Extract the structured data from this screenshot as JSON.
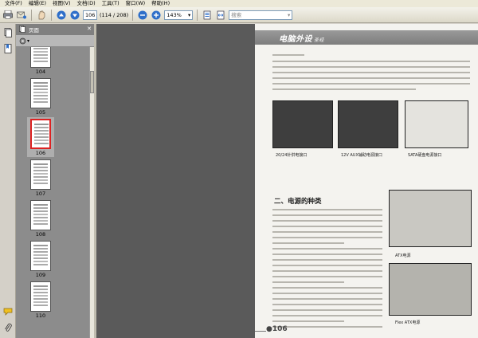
{
  "menu": {
    "items": [
      "文件(F)",
      "编辑(E)",
      "视图(V)",
      "文档(D)",
      "工具(T)",
      "窗口(W)",
      "帮助(H)"
    ]
  },
  "toolbar": {
    "page_number": "106",
    "page_count": "(114 / 208)",
    "zoom": "143%",
    "search_placeholder": "搜索"
  },
  "panel": {
    "title": "页面"
  },
  "thumbnails": [
    {
      "label": "104",
      "selected": false
    },
    {
      "label": "105",
      "selected": false
    },
    {
      "label": "106",
      "selected": true
    },
    {
      "label": "107",
      "selected": false
    },
    {
      "label": "108",
      "selected": false
    },
    {
      "label": "109",
      "selected": false
    },
    {
      "label": "110",
      "selected": false
    }
  ],
  "document": {
    "banner_title": "电脑外设",
    "banner_subtitle": "圣经",
    "section_heading": "二、电源的种类",
    "captions": [
      "20/24针供电接口",
      "12V AUX辅助电源接口",
      "SATA硬盘电源接口",
      "ATX电源",
      "Flex ATX电源"
    ],
    "page_number": "106"
  },
  "colors": {
    "selection_border": "#dd2222",
    "panel_bg": "#8c8c8c",
    "page_bg": "#f4f3ef"
  }
}
